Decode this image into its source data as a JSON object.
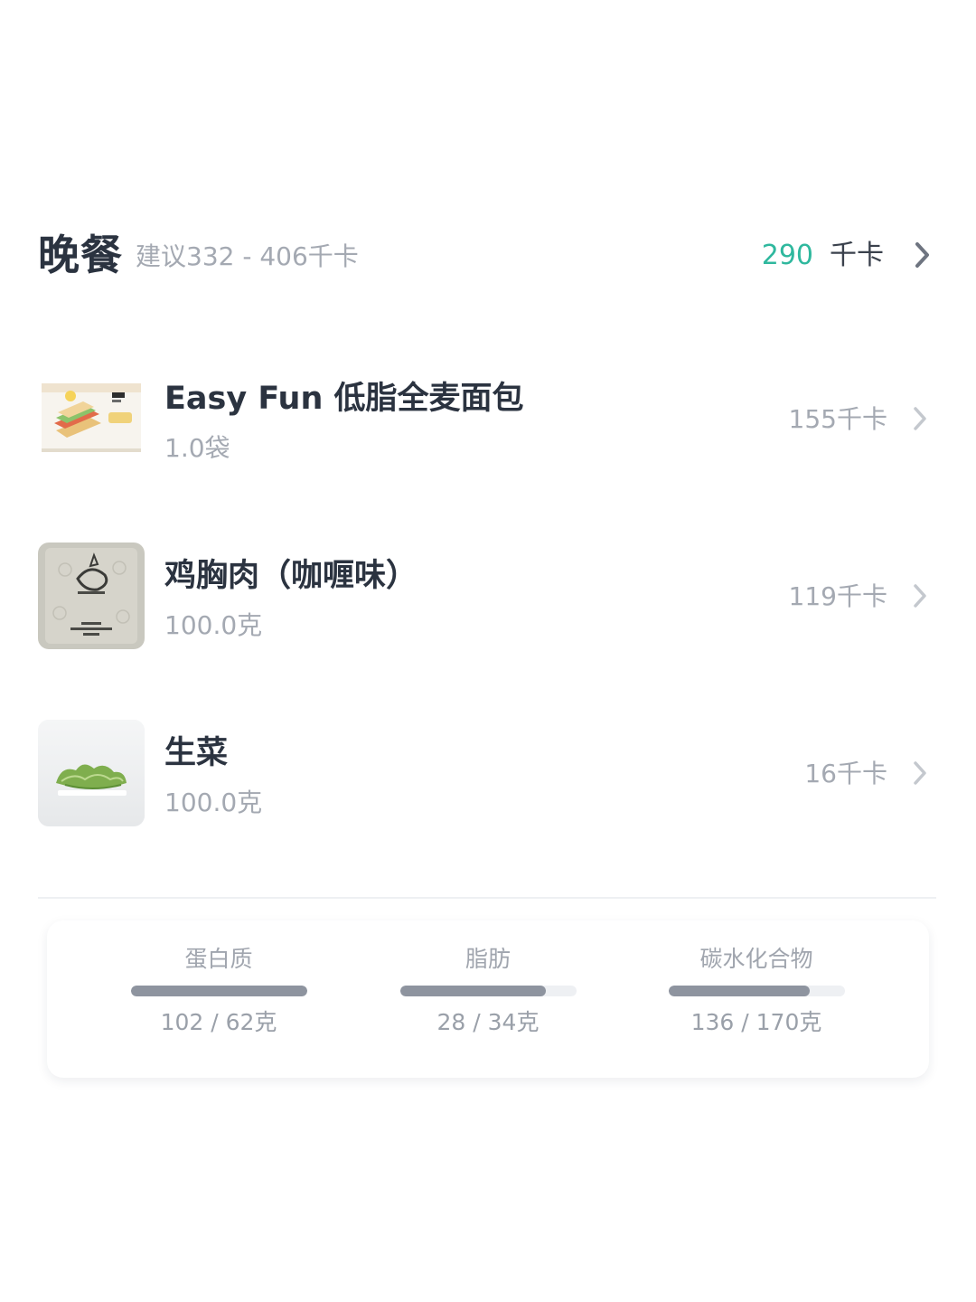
{
  "meal": {
    "title": "晚餐",
    "suggestion": "建议332 - 406千卡",
    "total_value": "290",
    "total_unit": "千卡",
    "accent_color": "#2fb89e",
    "chevron_icon": "chevron-right-icon"
  },
  "foods": [
    {
      "name": "Easy Fun 低脂全麦面包",
      "amount": "1.0袋",
      "kcal": "155千卡",
      "thumbnail": "bread-package-image"
    },
    {
      "name": "鸡胸肉（咖喱味）",
      "amount": "100.0克",
      "kcal": "119千卡",
      "thumbnail": "chicken-breast-package-image"
    },
    {
      "name": "生菜",
      "amount": "100.0克",
      "kcal": "16千卡",
      "thumbnail": "lettuce-image"
    }
  ],
  "macros": [
    {
      "label": "蛋白质",
      "value": "102 / 62克",
      "consumed": 102,
      "target": 62
    },
    {
      "label": "脂肪",
      "value": "28 / 34克",
      "consumed": 28,
      "target": 34
    },
    {
      "label": "碳水化合物",
      "value": "136 / 170克",
      "consumed": 136,
      "target": 170
    }
  ]
}
